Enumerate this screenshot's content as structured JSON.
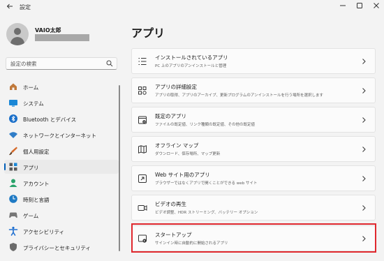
{
  "window": {
    "title": "設定",
    "back_icon": "back-arrow-icon",
    "controls": [
      "minimize-icon",
      "maximize-icon",
      "close-icon"
    ]
  },
  "profile": {
    "name": "VAIO太郎"
  },
  "search": {
    "placeholder": "設定の検索",
    "icon": "search-icon"
  },
  "sidebar": {
    "items": [
      {
        "label": "ホーム",
        "icon": "home-icon",
        "color": "#c0793b"
      },
      {
        "label": "システム",
        "icon": "system-icon",
        "color": "#1a87d6"
      },
      {
        "label": "Bluetooth とデバイス",
        "icon": "bluetooth-icon",
        "color": "#1a6fc9"
      },
      {
        "label": "ネットワークとインターネット",
        "icon": "wifi-icon",
        "color": "#2f7dc8"
      },
      {
        "label": "個人用設定",
        "icon": "brush-icon",
        "color": "#d56a2a"
      },
      {
        "label": "アプリ",
        "icon": "apps-icon",
        "color": "#5a5a5a",
        "active": true
      },
      {
        "label": "アカウント",
        "icon": "account-icon",
        "color": "#2aa36b"
      },
      {
        "label": "時刻と言語",
        "icon": "globe-clock-icon",
        "color": "#1f7ac4"
      },
      {
        "label": "ゲーム",
        "icon": "gamepad-icon",
        "color": "#777777"
      },
      {
        "label": "アクセシビリティ",
        "icon": "accessibility-icon",
        "color": "#1f6fd0"
      },
      {
        "label": "プライバシーとセキュリティ",
        "icon": "shield-icon",
        "color": "#6b6b6b"
      }
    ]
  },
  "main": {
    "title": "アプリ",
    "cards": [
      {
        "title": "インストールされているアプリ",
        "desc": "PC 上のアプリのアンインストールと管理",
        "icon": "installed-apps-icon"
      },
      {
        "title": "アプリの詳細設定",
        "desc": "アプリの取得、アプリのアーカイブ、更新プログラムのアンインストールを行う場所を選択します",
        "icon": "advanced-app-settings-icon"
      },
      {
        "title": "既定のアプリ",
        "desc": "ファイルの既定値、リンク種類の既定値、その他の既定値",
        "icon": "default-apps-icon"
      },
      {
        "title": "オフライン マップ",
        "desc": "ダウンロード、保存場所、マップ更新",
        "icon": "offline-maps-icon"
      },
      {
        "title": "Web サイト用のアプリ",
        "desc": "ブラウザーではなくアプリで開くことができる web サイト",
        "icon": "apps-for-websites-icon"
      },
      {
        "title": "ビデオの再生",
        "desc": "ビデオ調整、HDR ストリーミング、バッテリー オプション",
        "icon": "video-playback-icon"
      },
      {
        "title": "スタートアップ",
        "desc": "サインイン時に自動的に開始されるアプリ",
        "icon": "startup-icon"
      }
    ],
    "highlight_color": "#e0282e"
  }
}
